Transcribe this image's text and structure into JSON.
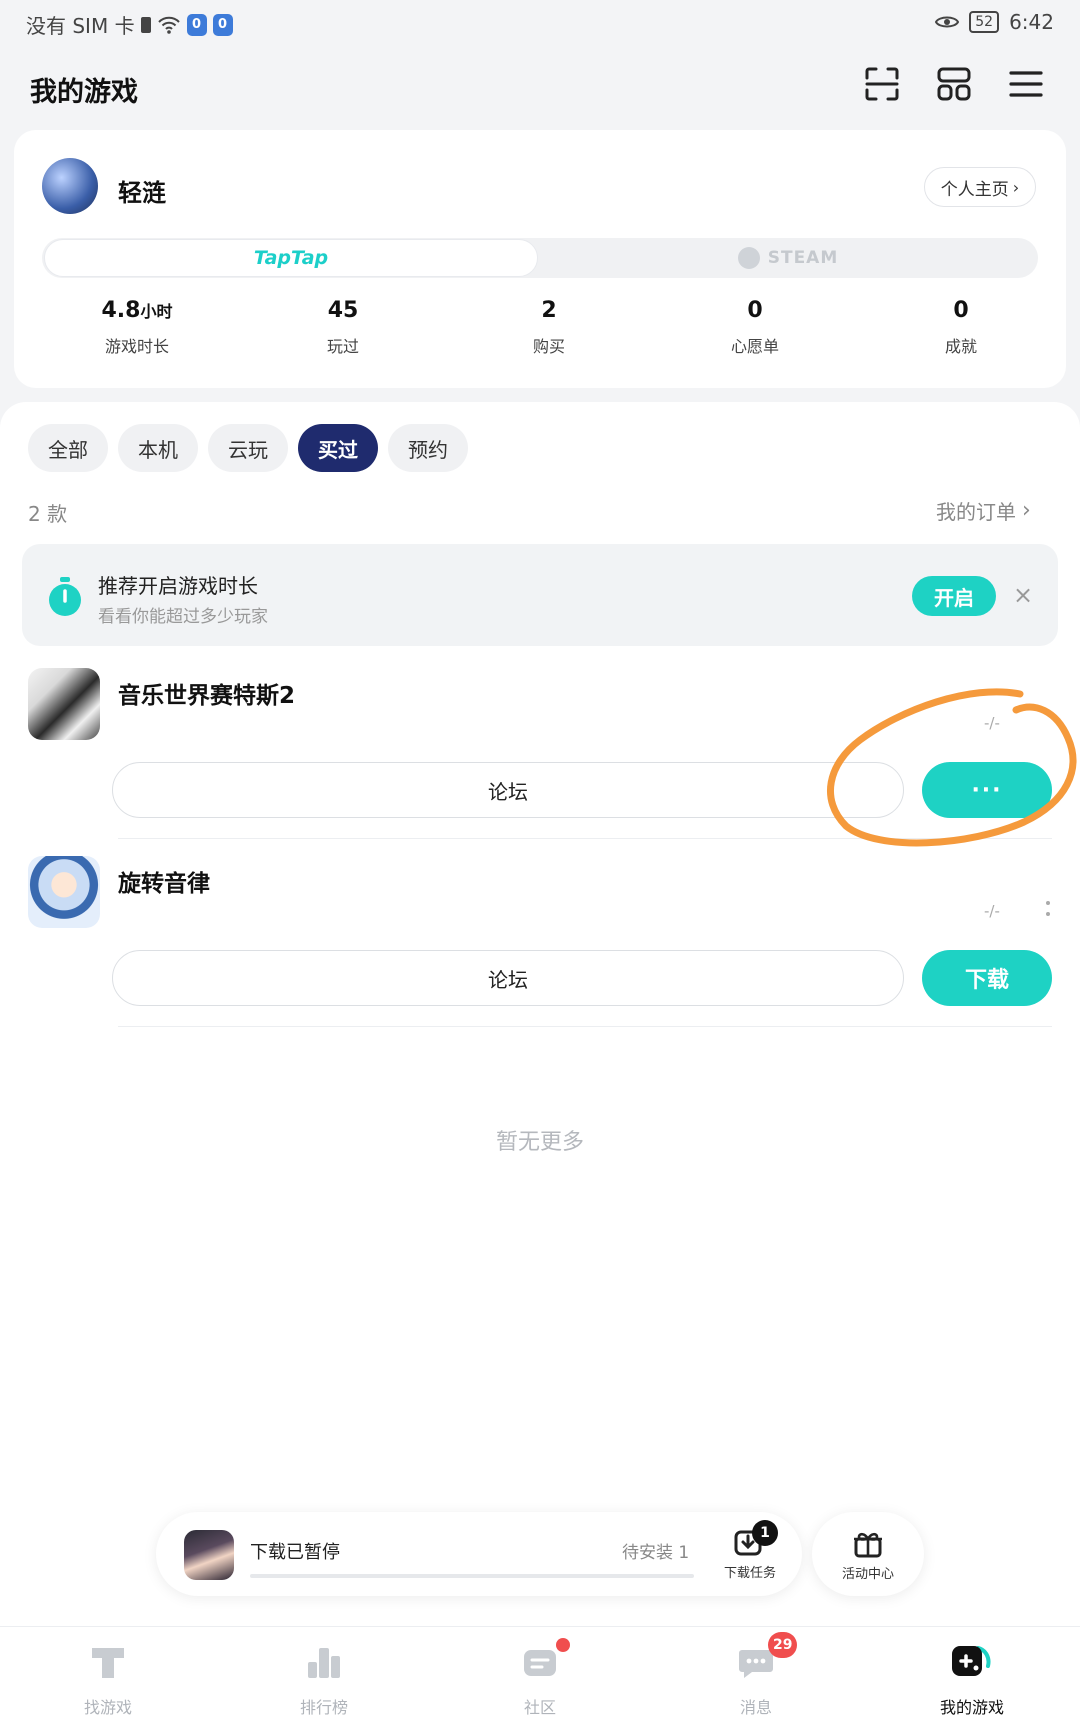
{
  "status_bar": {
    "carrier": "没有 SIM 卡",
    "sim1": "0",
    "sim2": "0",
    "battery": "52",
    "time": "6:42"
  },
  "header": {
    "title": "我的游戏"
  },
  "profile": {
    "username": "轻涟",
    "home_button": "个人主页",
    "platforms": [
      "TapTap",
      "STEAM"
    ],
    "stats": [
      {
        "value": "4.8",
        "unit": "小时",
        "label": "游戏时长"
      },
      {
        "value": "45",
        "unit": "",
        "label": "玩过"
      },
      {
        "value": "2",
        "unit": "",
        "label": "购买"
      },
      {
        "value": "0",
        "unit": "",
        "label": "心愿单"
      },
      {
        "value": "0",
        "unit": "",
        "label": "成就"
      }
    ]
  },
  "filters": {
    "items": [
      "全部",
      "本机",
      "云玩",
      "买过",
      "预约"
    ],
    "active": "买过"
  },
  "list_meta": {
    "count": "2 款",
    "orders_link": "我的订单"
  },
  "banner": {
    "title": "推荐开启游戏时长",
    "subtitle": "看看你能超过多少玩家",
    "button": "开启"
  },
  "games": [
    {
      "title": "音乐世界赛特斯2",
      "meta": "-/-",
      "forum": "论坛",
      "action": "···"
    },
    {
      "title": "旋转音律",
      "meta": "-/-",
      "forum": "论坛",
      "action": "下载"
    }
  ],
  "end_text": "暂无更多",
  "download_bar": {
    "status": "下载已暂停",
    "pending": "待安装 1",
    "task_label": "下载任务",
    "task_badge": "1",
    "activity_label": "活动中心"
  },
  "bottom_nav": {
    "items": [
      {
        "label": "找游戏",
        "icon": "find-games-icon"
      },
      {
        "label": "排行榜",
        "icon": "ranking-icon"
      },
      {
        "label": "社区",
        "icon": "community-icon"
      },
      {
        "label": "消息",
        "icon": "messages-icon",
        "badge": "29"
      },
      {
        "label": "我的游戏",
        "icon": "my-games-icon"
      }
    ],
    "active": "我的游戏"
  },
  "colors": {
    "accent": "#1ed2c4",
    "chip_active": "#1f2b6e",
    "badge_red": "#f04e4e",
    "annotation": "#f59a3c"
  }
}
